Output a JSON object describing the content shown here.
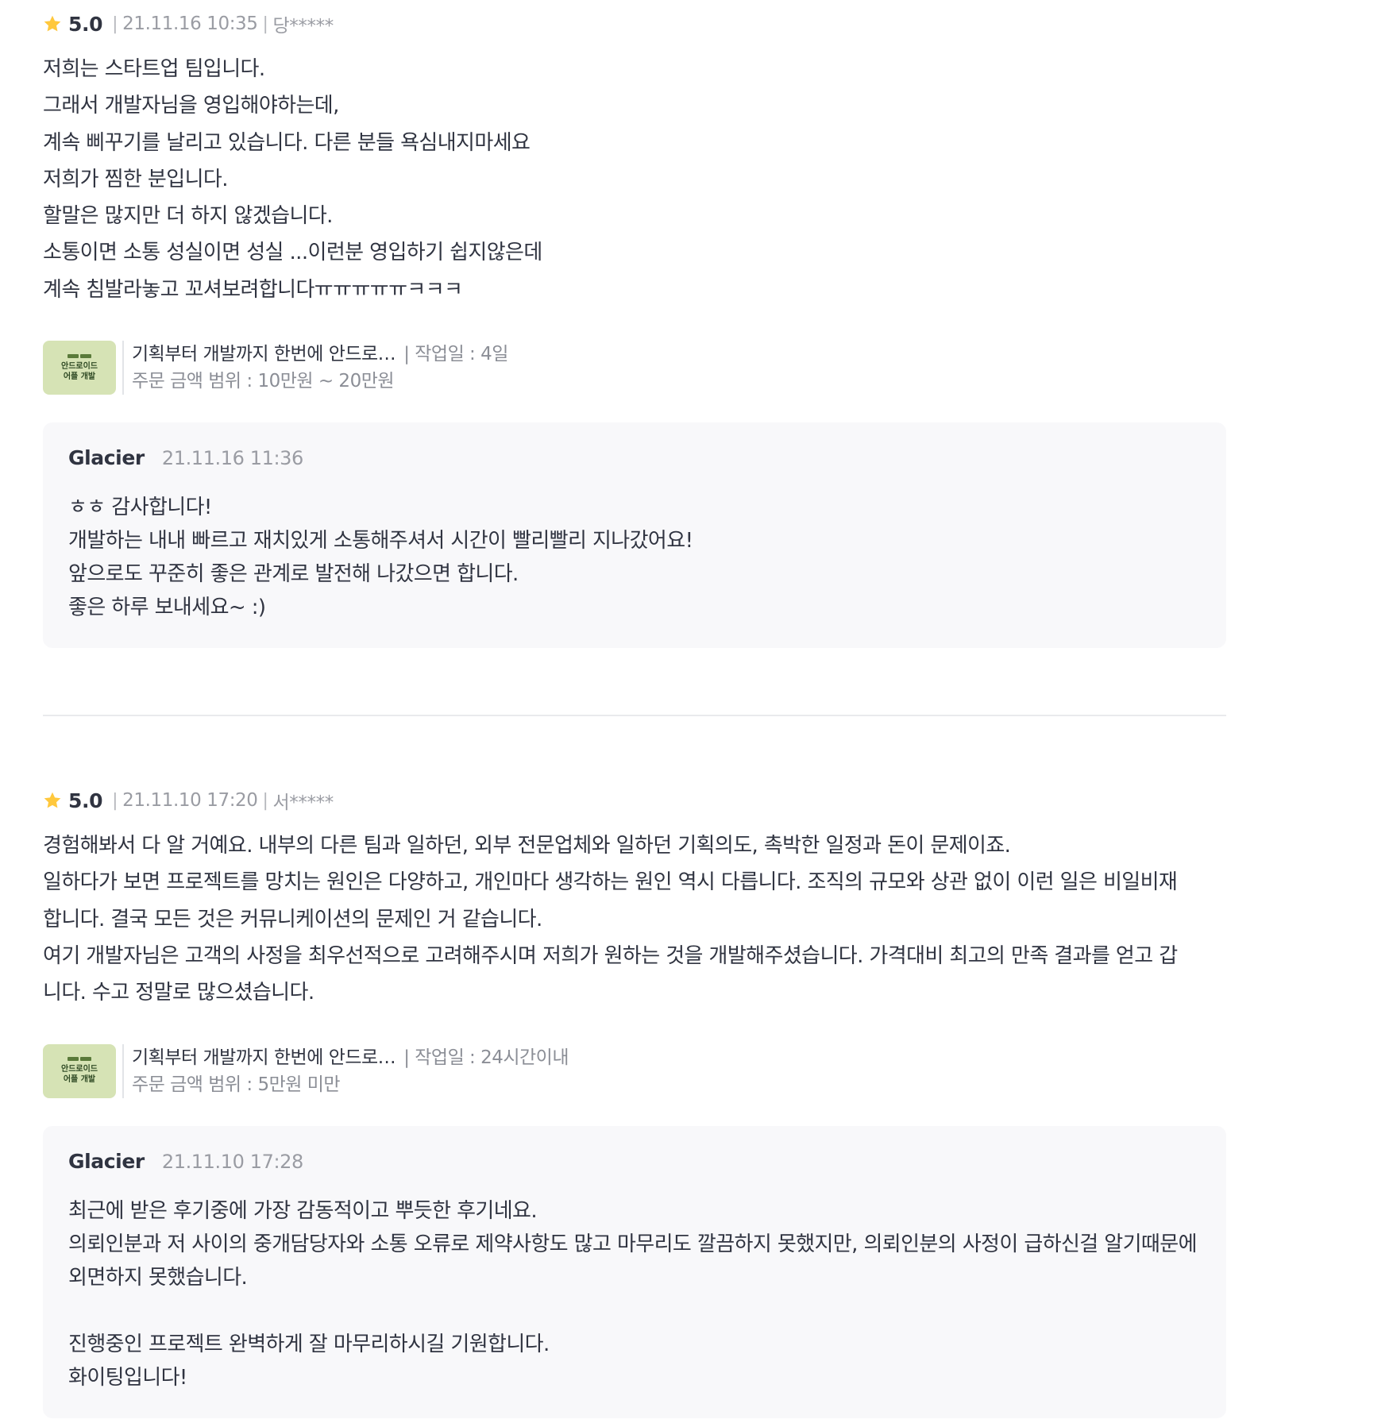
{
  "reviews": [
    {
      "rating": "5.0",
      "date": "21.11.16 10:35",
      "reviewer": "당*****",
      "body": "저희는 스타트업 팀입니다.\n그래서 개발자님을 영입해야하는데,\n계속 삐꾸기를 날리고 있습니다. 다른 분들 욕심내지마세요\n저희가 찜한 분입니다.\n할말은 많지만 더 하지 않겠습니다.\n소통이면 소통 성실이면 성실 ...이런분 영입하기 쉽지않은데\n계속 침발라놓고 꼬셔보려합니다ㅠㅠㅠㅠㅠㅋㅋㅋ",
      "service": {
        "thumb_title": "안드로이드",
        "thumb_subtitle": "어플 개발",
        "title": "기획부터 개발까지 한번에 안드로…",
        "work_days": "| 작업일 : 4일",
        "price_range": "주문 금액 범위 : 10만원 ~ 20만원"
      },
      "reply": {
        "name": "Glacier",
        "date": "21.11.16 11:36",
        "body": "ㅎㅎ 감사합니다!\n개발하는 내내 빠르고 재치있게 소통해주셔서 시간이 빨리빨리 지나갔어요!\n앞으로도 꾸준히 좋은 관계로 발전해 나갔으면 합니다.\n좋은 하루 보내세요~ :)"
      }
    },
    {
      "rating": "5.0",
      "date": "21.11.10 17:20",
      "reviewer": "서*****",
      "body": "경험해봐서 다 알 거예요. 내부의 다른 팀과 일하던, 외부 전문업체와 일하던 기획의도, 촉박한 일정과 돈이 문제이죠.\n일하다가 보면 프로젝트를 망치는 원인은 다양하고, 개인마다 생각하는 원인 역시 다릅니다. 조직의 규모와 상관 없이 이런 일은 비일비재합니다. 결국 모든 것은 커뮤니케이션의 문제인 거 같습니다.\n여기 개발자님은 고객의 사정을 최우선적으로 고려해주시며 저희가 원하는 것을 개발해주셨습니다. 가격대비 최고의 만족 결과를 얻고 갑니다. 수고 정말로 많으셨습니다.",
      "service": {
        "thumb_title": "안드로이드",
        "thumb_subtitle": "어플 개발",
        "title": "기획부터 개발까지 한번에 안드로…",
        "work_days": "| 작업일 : 24시간이내",
        "price_range": "주문 금액 범위 : 5만원 미만"
      },
      "reply": {
        "name": "Glacier",
        "date": "21.11.10 17:28",
        "body": "최근에 받은 후기중에 가장 감동적이고 뿌듯한 후기네요.\n의뢰인분과 저 사이의 중개담당자와 소통 오류로 제약사항도 많고 마무리도 깔끔하지 못했지만, 의뢰인분의 사정이 급하신걸 알기때문에 외면하지 못했습니다.\n\n진행중인 프로젝트 완벽하게 잘 마무리하시길 기원합니다.\n화이팅입니다!"
      }
    }
  ],
  "colors": {
    "star": "#FFC83D",
    "thumb_bg": "#D6E3B5",
    "reply_bg": "#F8F8FA",
    "divider": "#E9EAED"
  }
}
